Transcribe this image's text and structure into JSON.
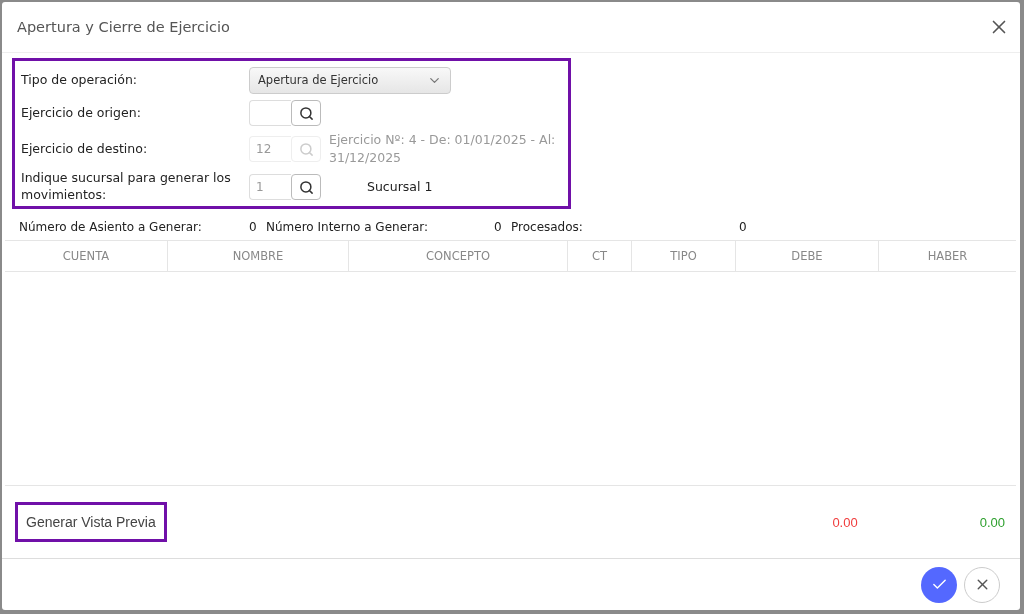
{
  "dialog": {
    "title": "Apertura y Cierre de Ejercicio"
  },
  "form": [
    {
      "kind": "select",
      "label": "Tipo de operación:",
      "value": "Apertura de Ejercicio",
      "disabled": false
    },
    {
      "kind": "lookup",
      "label": "Ejercicio de origen:",
      "disabled": false
    },
    {
      "kind": "lookup",
      "label": "Ejercicio de destino:",
      "value": "12",
      "disabled": true,
      "info": "Ejercicio Nº: 4 - De: 01/01/2025 - Al: 31/12/2025"
    },
    {
      "kind": "lookup",
      "label": "Indique sucursal para generar los movimientos:",
      "value": "1",
      "disabled": false,
      "info": "Sucursal 1"
    }
  ],
  "stats": [
    {
      "label": "Número de Asiento a Generar:",
      "value": "0"
    },
    {
      "label": "Número Interno a Generar:",
      "value": "0"
    },
    {
      "label": "Procesados:",
      "value": "0"
    }
  ],
  "table": {
    "columns": [
      "CUENTA",
      "NOMBRE",
      "CONCEPTO",
      "CT",
      "TIPO",
      "DEBE",
      "HABER"
    ]
  },
  "preview_button": "Generar Vista Previa",
  "totals": {
    "debe": "0.00",
    "haber": "0.00"
  }
}
